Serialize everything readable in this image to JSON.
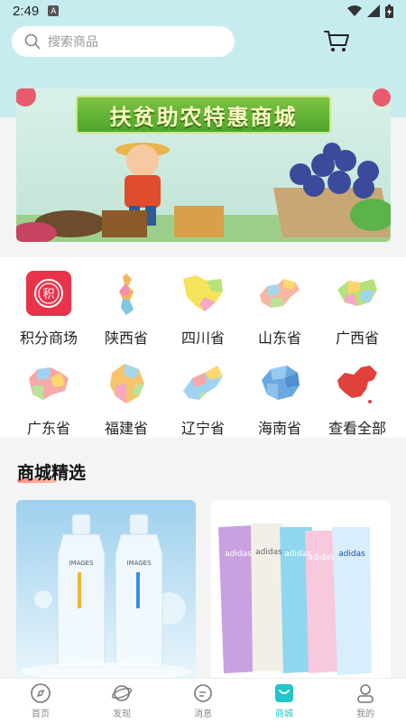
{
  "status_bar": {
    "time": "2:49",
    "notification_letter": "A"
  },
  "search": {
    "placeholder": "搜索商品"
  },
  "banner": {
    "title": "扶贫助农特惠商城"
  },
  "categories": [
    {
      "label": "积分商场",
      "icon": "points-mall-icon",
      "color": "#e8334b",
      "badge": "积"
    },
    {
      "label": "陕西省",
      "icon": "shaanxi-map-icon"
    },
    {
      "label": "四川省",
      "icon": "sichuan-map-icon"
    },
    {
      "label": "山东省",
      "icon": "shandong-map-icon"
    },
    {
      "label": "广西省",
      "icon": "guangxi-map-icon"
    },
    {
      "label": "广东省",
      "icon": "guangdong-map-icon"
    },
    {
      "label": "福建省",
      "icon": "fujian-map-icon"
    },
    {
      "label": "辽宁省",
      "icon": "liaoning-map-icon"
    },
    {
      "label": "海南省",
      "icon": "hainan-map-icon"
    },
    {
      "label": "查看全部",
      "icon": "china-map-icon"
    }
  ],
  "section": {
    "title": "商城精选"
  },
  "products": [
    {
      "name": "images-hyaluronic-ampoule",
      "brand": "IMAGES"
    },
    {
      "name": "adidas-shower-gel-set",
      "brand": "adidas"
    }
  ],
  "tabs": [
    {
      "label": "首页",
      "icon": "home-icon"
    },
    {
      "label": "发现",
      "icon": "discover-icon"
    },
    {
      "label": "消息",
      "icon": "message-icon"
    },
    {
      "label": "商城",
      "icon": "shop-icon",
      "active": true
    },
    {
      "label": "我的",
      "icon": "profile-icon"
    }
  ],
  "colors": {
    "accent": "#21c6c9",
    "header_bg": "#c7ecef",
    "points_red": "#e8334b"
  }
}
